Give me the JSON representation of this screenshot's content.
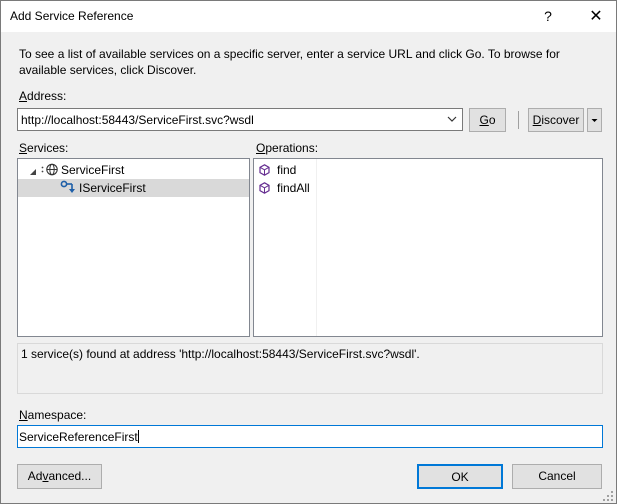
{
  "window": {
    "title": "Add Service Reference",
    "help_label": "?",
    "close_label": "✕"
  },
  "description": "To see a list of available services on a specific server, enter a service URL and click Go. To browse for available services, click Discover.",
  "address": {
    "label_accel": "A",
    "label_rest": "ddress:",
    "value": "http://localhost:58443/ServiceFirst.svc?wsdl"
  },
  "buttons": {
    "go_accel": "G",
    "go_rest": "o",
    "discover_accel": "D",
    "discover_rest": "iscover",
    "advanced_pre": "Ad",
    "advanced_accel": "v",
    "advanced_rest": "anced...",
    "ok": "OK",
    "cancel": "Cancel"
  },
  "services": {
    "label_accel": "S",
    "label_rest": "ervices:",
    "items": [
      {
        "label": "ServiceFirst",
        "expanded": true,
        "icon": "web-service-icon"
      },
      {
        "label": "IServiceFirst",
        "selected": true,
        "icon": "interface-icon"
      }
    ]
  },
  "operations": {
    "label_accel": "O",
    "label_rest": "perations:",
    "items": [
      {
        "label": "find",
        "icon": "method-icon"
      },
      {
        "label": "findAll",
        "icon": "method-icon"
      }
    ]
  },
  "status": "1 service(s) found at address 'http://localhost:58443/ServiceFirst.svc?wsdl'.",
  "namespace": {
    "label_accel": "N",
    "label_rest": "amespace:",
    "value": "ServiceReferenceFirst"
  },
  "colors": {
    "focus_accent": "#0078d7",
    "method_icon": "#652d90",
    "selection": "#d9d9d9"
  }
}
